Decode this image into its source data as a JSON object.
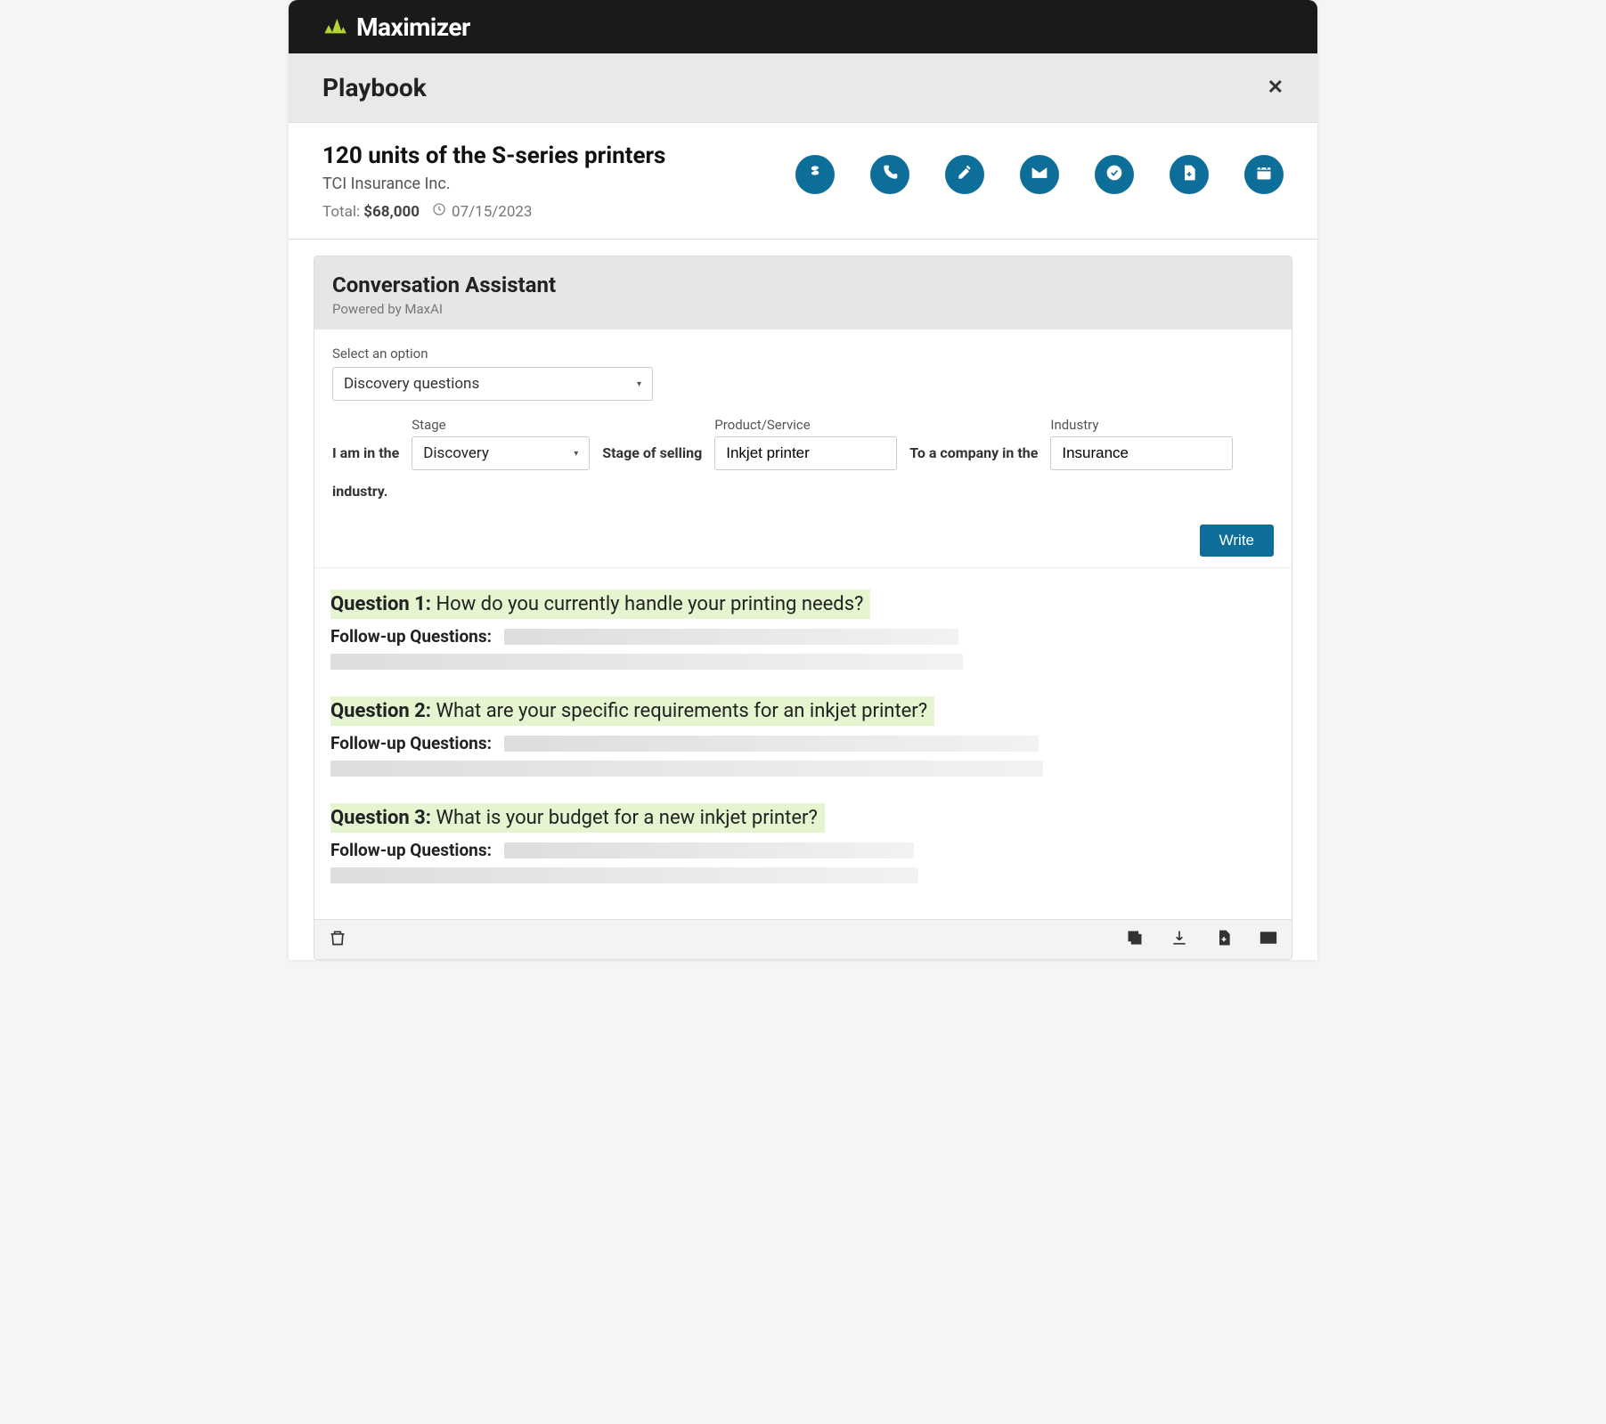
{
  "brand": {
    "name": "Maximizer"
  },
  "playbook": {
    "title": "Playbook"
  },
  "deal": {
    "title": "120 units of the S-series printers",
    "company": "TCI Insurance Inc.",
    "total_label": "Total:",
    "total_amount": "$68,000",
    "date": "07/15/2023"
  },
  "assistant": {
    "title": "Conversation Assistant",
    "subtitle": "Powered by MaxAI",
    "option_label": "Select an option",
    "option_value": "Discovery questions",
    "sentence": {
      "prefix": "I am in the",
      "stage_label": "Stage",
      "stage_value": "Discovery",
      "mid1": "Stage of selling",
      "product_label": "Product/Service",
      "product_value": "Inkjet printer",
      "mid2": "To a company in the",
      "industry_label": "Industry",
      "industry_value": "Insurance",
      "suffix": "industry."
    },
    "write_label": "Write"
  },
  "questions": [
    {
      "num": "Question 1:",
      "text": "How do you currently handle your printing needs?",
      "follow_label": "Follow-up Questions:"
    },
    {
      "num": "Question 2:",
      "text": "What are your specific requirements for an inkjet printer?",
      "follow_label": "Follow-up Questions:"
    },
    {
      "num": "Question 3:",
      "text": "What is your budget for a new inkjet printer?",
      "follow_label": "Follow-up Questions:"
    }
  ]
}
